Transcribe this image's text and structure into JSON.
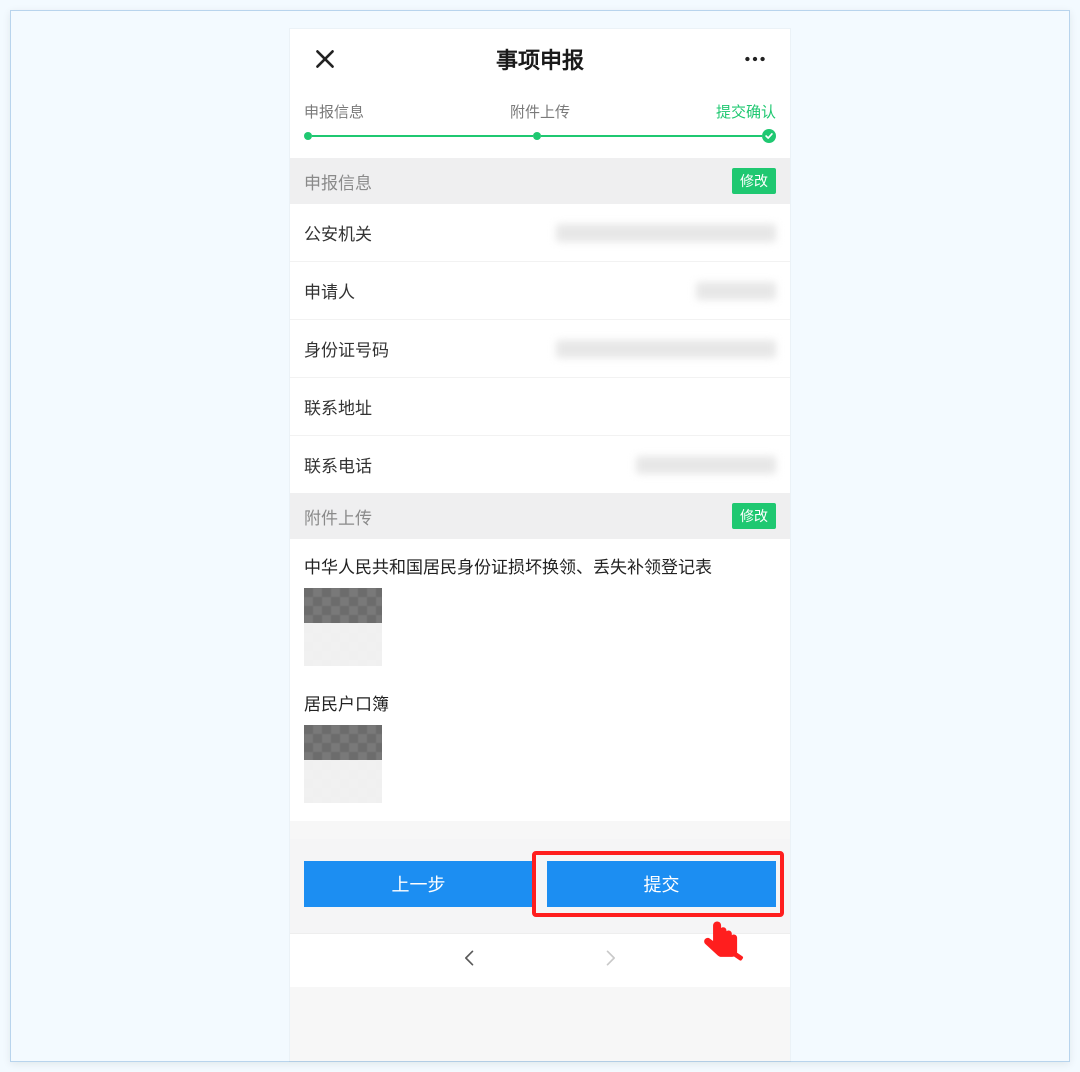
{
  "header": {
    "title": "事项申报",
    "close_icon": "close",
    "more_icon": "more"
  },
  "steps": {
    "items": [
      {
        "label": "申报信息",
        "active": false
      },
      {
        "label": "附件上传",
        "active": false
      },
      {
        "label": "提交确认",
        "active": true
      }
    ]
  },
  "sections": {
    "info": {
      "title": "申报信息",
      "edit_label": "修改",
      "rows": [
        {
          "label": "公安机关",
          "value_size": "lg"
        },
        {
          "label": "申请人",
          "value_size": "sm"
        },
        {
          "label": "身份证号码",
          "value_size": "lg"
        },
        {
          "label": "联系地址",
          "value_size": "none"
        },
        {
          "label": "联系电话",
          "value_size": "md"
        }
      ]
    },
    "attach": {
      "title": "附件上传",
      "edit_label": "修改",
      "items": [
        {
          "title": "中华人民共和国居民身份证损坏换领、丢失补领登记表"
        },
        {
          "title": "居民户口簿"
        }
      ]
    }
  },
  "footer": {
    "prev_label": "上一步",
    "submit_label": "提交"
  },
  "annotations": {
    "highlight": "submit-button",
    "cursor_icon": "tap-hand"
  }
}
